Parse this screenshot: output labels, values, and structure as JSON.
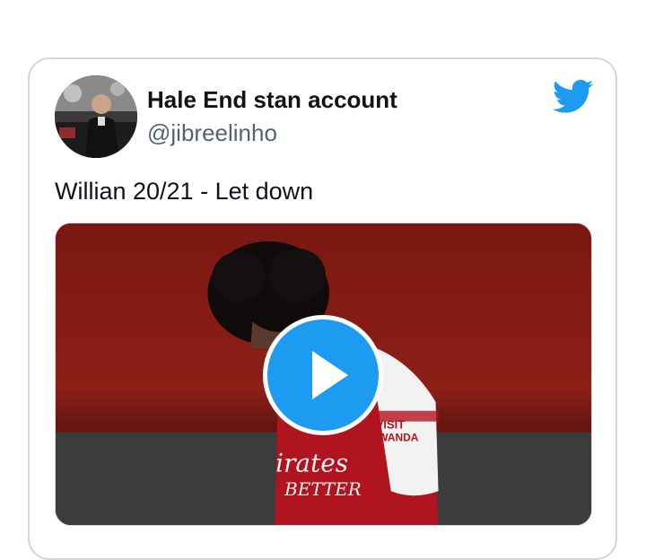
{
  "tweet": {
    "display_name": "Hale End stan account",
    "handle": "@jibreelinho",
    "text": "Willian 20/21 - Let down",
    "media": {
      "type": "video",
      "shirt_sponsor_top": "VISIT",
      "shirt_sponsor_bottom": "RWANDA",
      "chest_text_top": "irates",
      "chest_text_bottom": "BETTER"
    }
  },
  "colors": {
    "twitter_blue": "#1d9bf0",
    "name_text": "#0f1419",
    "handle_text": "#536471",
    "card_border": "#cfd9de"
  },
  "icons": {
    "brand": "twitter-bird-icon",
    "media": "play-icon"
  }
}
